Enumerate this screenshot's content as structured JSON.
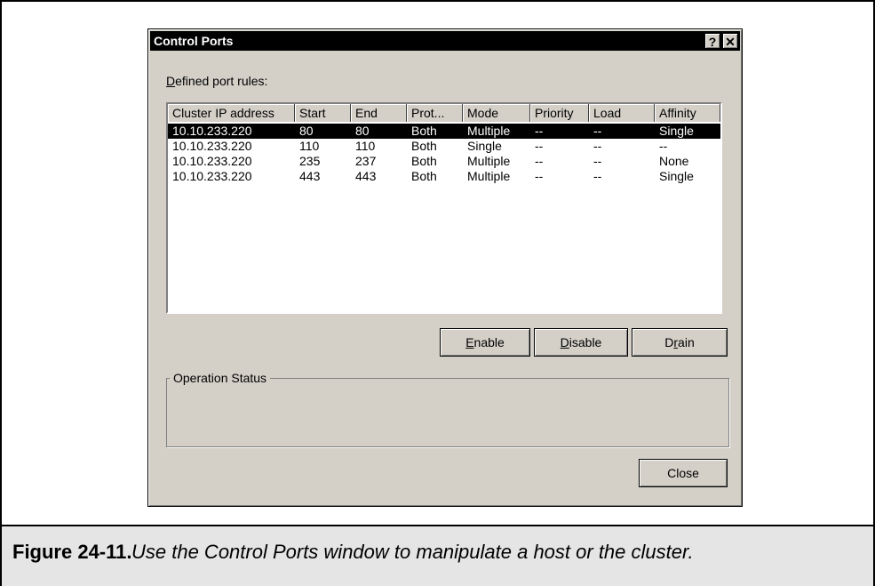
{
  "dialog": {
    "title": "Control Ports",
    "help_label": "?",
    "close_glyph": "✕",
    "list_label_first": "D",
    "list_label_rest": "efined port rules:",
    "columns": [
      "Cluster IP address",
      "Start",
      "End",
      "Prot...",
      "Mode",
      "Priority",
      "Load",
      "Affinity"
    ],
    "rows": [
      [
        "10.10.233.220",
        "80",
        "80",
        "Both",
        "Multiple",
        "--",
        "--",
        "Single"
      ],
      [
        "10.10.233.220",
        "110",
        "110",
        "Both",
        "Single",
        "--",
        "--",
        "--"
      ],
      [
        "10.10.233.220",
        "235",
        "237",
        "Both",
        "Multiple",
        "--",
        "--",
        "None"
      ],
      [
        "10.10.233.220",
        "443",
        "443",
        "Both",
        "Multiple",
        "--",
        "--",
        "Single"
      ]
    ],
    "selected_row": 0,
    "buttons": {
      "enable_first": "E",
      "enable_rest": "nable",
      "disable_first": "D",
      "disable_rest": "isable",
      "drain_pre": "D",
      "drain_u": "r",
      "drain_rest": "ain",
      "close": "Close"
    },
    "operation_status_label": "Operation Status"
  },
  "caption": {
    "number": "Figure 24-11.",
    "text": "Use the Control Ports window to manipulate a host or the cluster."
  }
}
